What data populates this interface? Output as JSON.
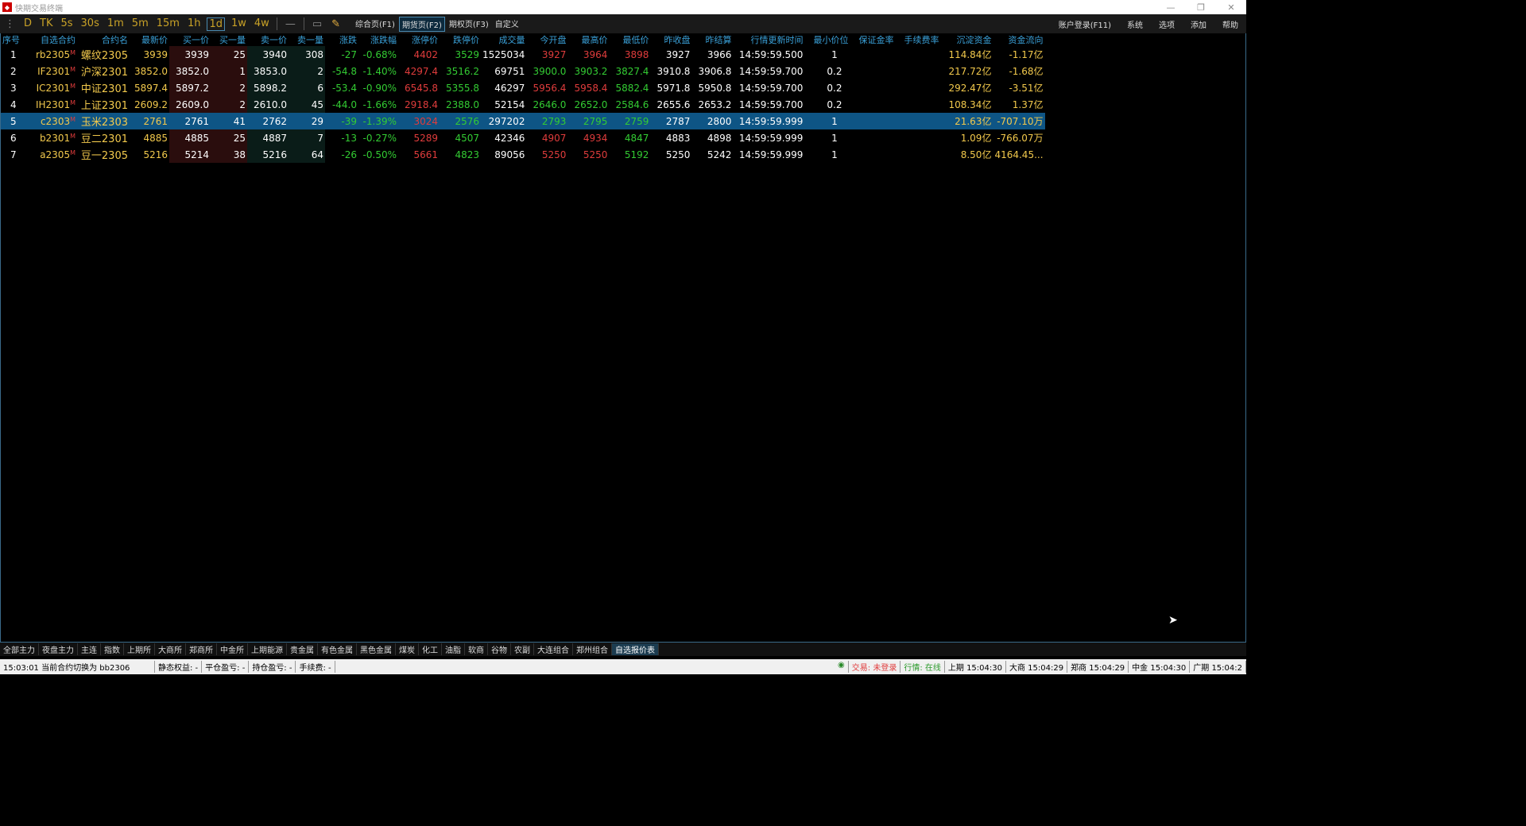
{
  "window": {
    "title": "快期交易终端",
    "buttons": [
      "—",
      "❐",
      "✕"
    ]
  },
  "toolbar": {
    "periods": [
      "D",
      "TK",
      "5s",
      "30s",
      "1m",
      "5m",
      "15m",
      "1h",
      "1d",
      "1w",
      "4w"
    ],
    "active_period": "1d",
    "tabs": [
      "综合页(F1)",
      "期货页(F2)",
      "期权页(F3)",
      "自定义"
    ],
    "active_tab": "期货页(F2)",
    "right_menu": [
      "账户登录(F11)",
      "系统",
      "选项",
      "添加",
      "帮助"
    ]
  },
  "table": {
    "headers": [
      "序号",
      "自选合约",
      "合约名",
      "最新价",
      "买一价",
      "买一量",
      "卖一价",
      "卖一量",
      "涨跌",
      "涨跌幅",
      "涨停价",
      "跌停价",
      "成交量",
      "今开盘",
      "最高价",
      "最低价",
      "昨收盘",
      "昨结算",
      "行情更新时间",
      "最小价位",
      "保证金率",
      "手续费率",
      "沉淀资金",
      "资金流向"
    ],
    "rows": [
      {
        "idx": "1",
        "code": "rb2305",
        "name": "螺纹2305",
        "last": "3939",
        "bid": "3939",
        "bidvol": "25",
        "ask": "3940",
        "askvol": "308",
        "chg": "-27",
        "pct": "-0.68%",
        "upper": "4402",
        "lower": "3529",
        "vol": "1525034",
        "open": "3927",
        "high": "3964",
        "low": "3898",
        "preclose": "3927",
        "presettle": "3966",
        "time": "14:59:59.500",
        "tick": "1",
        "margin": "",
        "fee": "",
        "fund": "114.84亿",
        "flow": "-1.17亿",
        "dir": "down",
        "open_dir": "up",
        "high_dir": "up",
        "low_dir": "up"
      },
      {
        "idx": "2",
        "code": "IF2301",
        "name": "沪深2301",
        "last": "3852.0",
        "bid": "3852.0",
        "bidvol": "1",
        "ask": "3853.0",
        "askvol": "2",
        "chg": "-54.8",
        "pct": "-1.40%",
        "upper": "4297.4",
        "lower": "3516.2",
        "vol": "69751",
        "open": "3900.0",
        "high": "3903.2",
        "low": "3827.4",
        "preclose": "3910.8",
        "presettle": "3906.8",
        "time": "14:59:59.700",
        "tick": "0.2",
        "margin": "",
        "fee": "",
        "fund": "217.72亿",
        "flow": "-1.68亿",
        "dir": "down",
        "open_dir": "down",
        "high_dir": "down",
        "low_dir": "down"
      },
      {
        "idx": "3",
        "code": "IC2301",
        "name": "中证2301",
        "last": "5897.4",
        "bid": "5897.2",
        "bidvol": "2",
        "ask": "5898.2",
        "askvol": "6",
        "chg": "-53.4",
        "pct": "-0.90%",
        "upper": "6545.8",
        "lower": "5355.8",
        "vol": "46297",
        "open": "5956.4",
        "high": "5958.4",
        "low": "5882.4",
        "preclose": "5971.8",
        "presettle": "5950.8",
        "time": "14:59:59.700",
        "tick": "0.2",
        "margin": "",
        "fee": "",
        "fund": "292.47亿",
        "flow": "-3.51亿",
        "dir": "down",
        "open_dir": "up",
        "high_dir": "up",
        "low_dir": "down"
      },
      {
        "idx": "4",
        "code": "IH2301",
        "name": "上证2301",
        "last": "2609.2",
        "bid": "2609.0",
        "bidvol": "2",
        "ask": "2610.0",
        "askvol": "45",
        "chg": "-44.0",
        "pct": "-1.66%",
        "upper": "2918.4",
        "lower": "2388.0",
        "vol": "52154",
        "open": "2646.0",
        "high": "2652.0",
        "low": "2584.6",
        "preclose": "2655.6",
        "presettle": "2653.2",
        "time": "14:59:59.700",
        "tick": "0.2",
        "margin": "",
        "fee": "",
        "fund": "108.34亿",
        "flow": "1.37亿",
        "dir": "down",
        "open_dir": "down",
        "high_dir": "down",
        "low_dir": "down"
      },
      {
        "idx": "5",
        "code": "c2303",
        "name": "玉米2303",
        "last": "2761",
        "bid": "2761",
        "bidvol": "41",
        "ask": "2762",
        "askvol": "29",
        "chg": "-39",
        "pct": "-1.39%",
        "upper": "3024",
        "lower": "2576",
        "vol": "297202",
        "open": "2793",
        "high": "2795",
        "low": "2759",
        "preclose": "2787",
        "presettle": "2800",
        "time": "14:59:59.999",
        "tick": "1",
        "margin": "",
        "fee": "",
        "fund": "21.63亿",
        "flow": "-707.10万",
        "dir": "down",
        "open_dir": "down",
        "high_dir": "down",
        "low_dir": "down"
      },
      {
        "idx": "6",
        "code": "b2301",
        "name": "豆二2301",
        "last": "4885",
        "bid": "4885",
        "bidvol": "25",
        "ask": "4887",
        "askvol": "7",
        "chg": "-13",
        "pct": "-0.27%",
        "upper": "5289",
        "lower": "4507",
        "vol": "42346",
        "open": "4907",
        "high": "4934",
        "low": "4847",
        "preclose": "4883",
        "presettle": "4898",
        "time": "14:59:59.999",
        "tick": "1",
        "margin": "",
        "fee": "",
        "fund": "1.09亿",
        "flow": "-766.07万",
        "dir": "down",
        "open_dir": "up",
        "high_dir": "up",
        "low_dir": "down"
      },
      {
        "idx": "7",
        "code": "a2305",
        "name": "豆一2305",
        "last": "5216",
        "bid": "5214",
        "bidvol": "38",
        "ask": "5216",
        "askvol": "64",
        "chg": "-26",
        "pct": "-0.50%",
        "upper": "5661",
        "lower": "4823",
        "vol": "89056",
        "open": "5250",
        "high": "5250",
        "low": "5192",
        "preclose": "5250",
        "presettle": "5242",
        "time": "14:59:59.999",
        "tick": "1",
        "margin": "",
        "fee": "",
        "fund": "8.50亿",
        "flow": "4164.45...",
        "dir": "down",
        "open_dir": "up",
        "high_dir": "up",
        "low_dir": "down"
      }
    ],
    "selected_row": 4,
    "code_suffix": "M"
  },
  "bottom_tabs": [
    "全部主力",
    "夜盘主力",
    "主连",
    "指数",
    "上期所",
    "大商所",
    "郑商所",
    "中金所",
    "上期能源",
    "贵金属",
    "有色金属",
    "黑色金属",
    "煤炭",
    "化工",
    "油脂",
    "软商",
    "谷物",
    "农副",
    "大连组合",
    "郑州组合",
    "自选报价表"
  ],
  "active_bottom_tab": "自选报价表",
  "status": {
    "message": "15:03:01 当前合约切换为 bb2306",
    "fields": [
      "静态权益: -",
      "平仓盈亏: -",
      "持仓盈亏: -",
      "手续费: -"
    ],
    "trade": "交易: 未登录",
    "quote": "行情: 在线",
    "exchanges": [
      "上期 15:04:30",
      "大商 15:04:29",
      "郑商 15:04:29",
      "中金 15:04:30",
      "广期 15:04:2"
    ]
  },
  "colors": {
    "up": "#e03c3c",
    "down": "#33cc33",
    "header": "#3aa0d8",
    "accent": "#f2c94c",
    "selected": "#0e5585"
  }
}
